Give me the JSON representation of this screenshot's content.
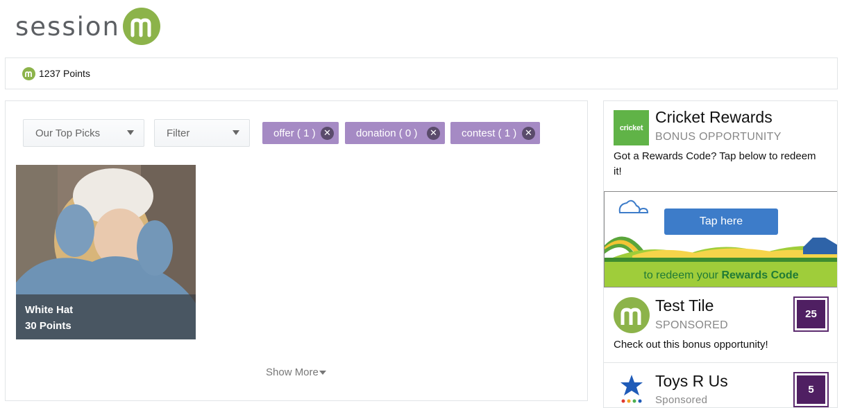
{
  "brand": {
    "logo_text": "session",
    "accent": "#8cb34a"
  },
  "points_bar": {
    "points_label": "1237 Points"
  },
  "filters": {
    "sort_selected": "Our Top Picks",
    "filter_selected": "Filter",
    "tags": [
      {
        "label": "offer ( 1 )"
      },
      {
        "label": "donation ( 0 )"
      },
      {
        "label": "contest ( 1 )"
      }
    ],
    "tag_color": "#a58ac4"
  },
  "tiles": [
    {
      "title": "White Hat",
      "points": "30 Points"
    }
  ],
  "show_more_label": "Show More",
  "sidebar": {
    "cricket": {
      "logo_text": "cricket",
      "title": "Cricket Rewards",
      "subtitle": "BONUS OPPORTUNITY",
      "description": "Got a Rewards Code? Tap below to redeem it!"
    },
    "banner": {
      "button_label": "Tap here",
      "text_prefix": "to redeem your",
      "text_bold": "Rewards Code"
    },
    "test_tile": {
      "title": "Test Tile",
      "subtitle": "SPONSORED",
      "description": "Check out this bonus opportunity!",
      "badge": "25"
    },
    "toys": {
      "title": "Toys R Us",
      "subtitle": "Sponsored",
      "badge": "5"
    },
    "badge_color": "#4f1f62"
  }
}
